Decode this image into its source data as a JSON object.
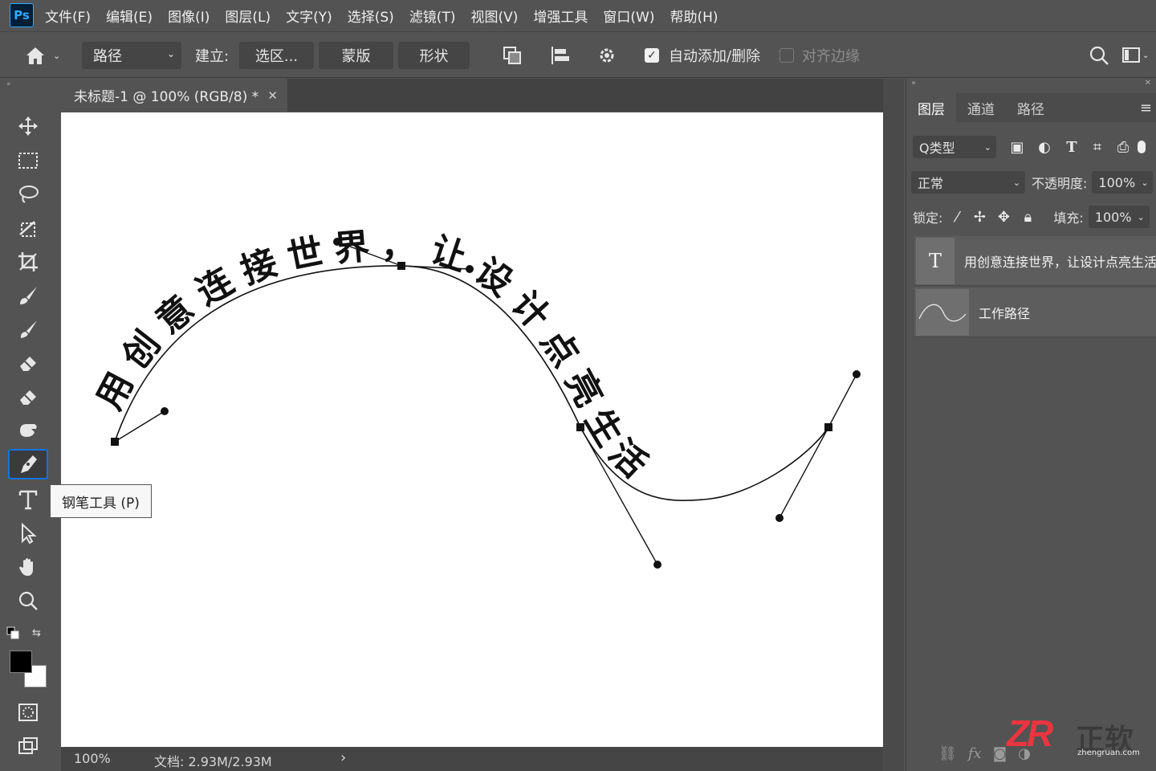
{
  "app": {
    "logo": "Ps"
  },
  "menu": [
    "文件(F)",
    "编辑(E)",
    "图像(I)",
    "图层(L)",
    "文字(Y)",
    "选择(S)",
    "滤镜(T)",
    "视图(V)",
    "增强工具",
    "窗口(W)",
    "帮助(H)"
  ],
  "options": {
    "mode_value": "路径",
    "make_label": "建立:",
    "selection_button": "选区...",
    "mask_button": "蒙版",
    "shape_button": "形状",
    "auto_add_delete": "自动添加/删除",
    "auto_add_delete_checked": true,
    "align_edges": "对齐边缘",
    "align_edges_checked": false
  },
  "document": {
    "tab_title": "未标题-1 @ 100% (RGB/8) *",
    "zoom": "100%",
    "doc_info": "文档: 2.93M/2.93M",
    "path_text_chars": [
      "用",
      "创",
      "意",
      "连",
      "接",
      "世",
      "界",
      "，",
      "让",
      "设",
      "计",
      "点",
      "亮",
      "生",
      "活"
    ]
  },
  "tooltip": "钢笔工具 (P)",
  "layers_panel": {
    "tabs": [
      "图层",
      "通道",
      "路径"
    ],
    "filter_label": "Q类型",
    "blend_mode": "正常",
    "opacity_label": "不透明度:",
    "opacity_value": "100%",
    "lock_label": "锁定:",
    "fill_label": "填充:",
    "fill_value": "100%",
    "layers": [
      {
        "name": "用创意连接世界，让设计点亮生活",
        "thumb": "T"
      },
      {
        "name": "工作路径",
        "thumb": "path"
      }
    ]
  },
  "watermark": {
    "logo": "ZR",
    "text": "正软",
    "url": "zhengruan.com"
  },
  "colors": {
    "accent": "#1473e6",
    "panel": "#535353",
    "canvas": "#ffffff",
    "watermark_red": "#e8353f"
  }
}
